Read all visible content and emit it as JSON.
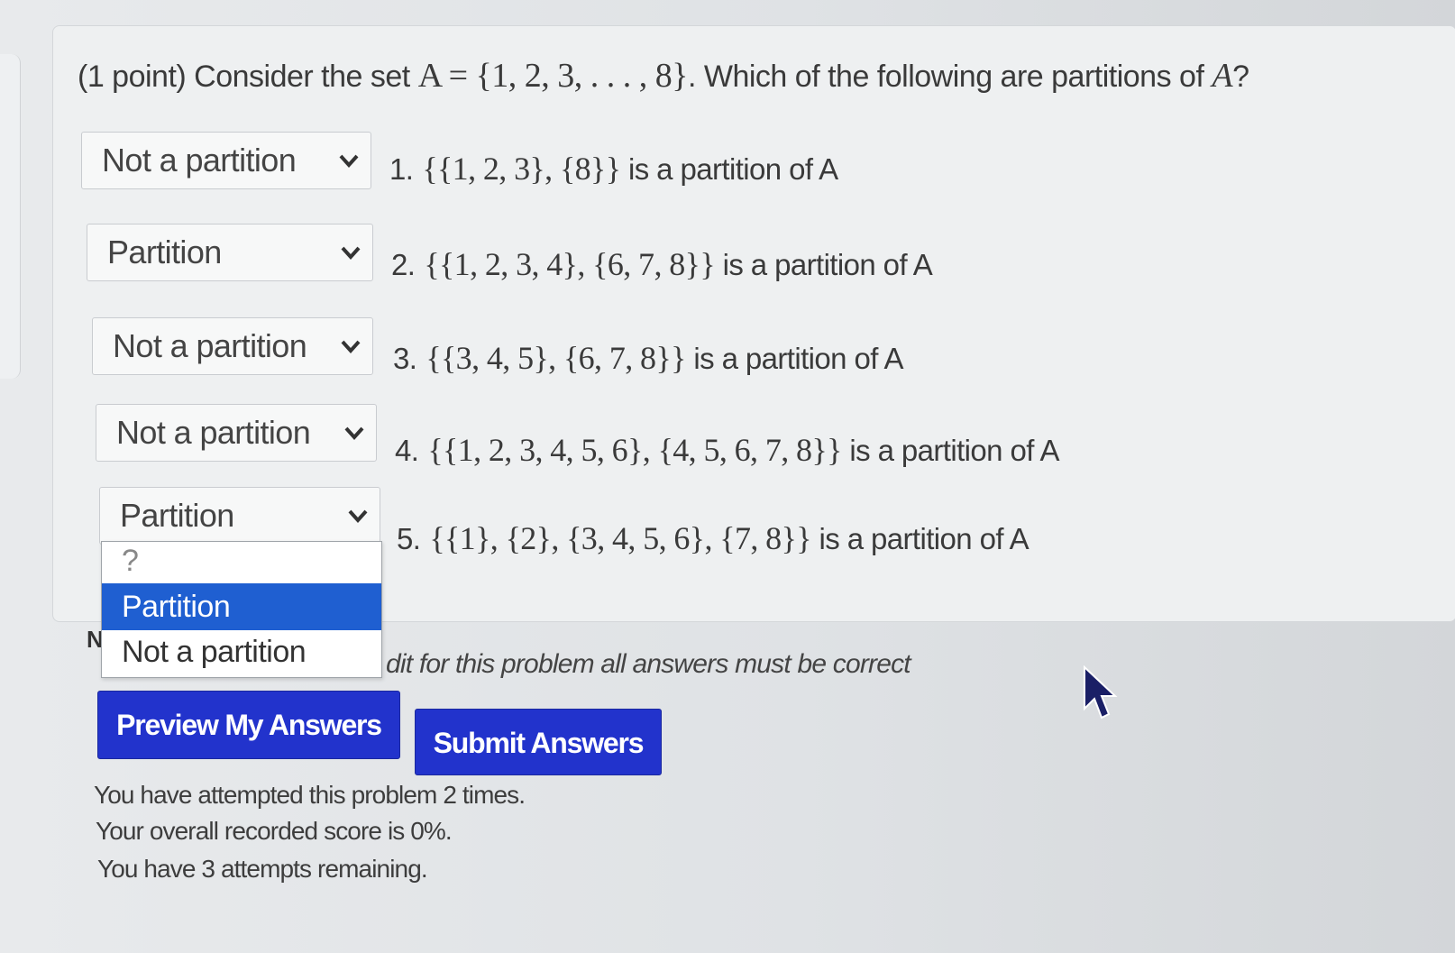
{
  "question": {
    "prefix": "(1 point) Consider the set",
    "set_math": "A = {1, 2, 3, . . . , 8}",
    "suffix": ". Which of the following are partitions of",
    "set_var": "A",
    "end": "?"
  },
  "items": [
    {
      "selected": "Not a partition",
      "number": "1.",
      "set_math": "{{1, 2, 3}, {8}}",
      "tail": "is a partition of A"
    },
    {
      "selected": "Partition",
      "number": "2.",
      "set_math": "{{1, 2, 3, 4}, {6, 7, 8}}",
      "tail": "is a partition of A"
    },
    {
      "selected": "Not a partition",
      "number": "3.",
      "set_math": "{{3, 4, 5}, {6, 7, 8}}",
      "tail": "is a partition of A"
    },
    {
      "selected": "Not a partition",
      "number": "4.",
      "set_math": "{{1, 2, 3, 4, 5, 6}, {4, 5, 6, 7, 8}}",
      "tail": "is a partition of A"
    },
    {
      "selected": "Partition",
      "number": "5.",
      "set_math": "{{1}, {2}, {3, 4, 5, 6}, {7, 8}}",
      "tail": "is a partition of A"
    }
  ],
  "dropdown": {
    "options": [
      "?",
      "Partition",
      "Not a partition"
    ],
    "highlighted": "Partition"
  },
  "note": {
    "prefix": "N",
    "visible_text": "dit for this problem all answers must be correct"
  },
  "buttons": {
    "preview": "Preview My Answers",
    "submit": "Submit Answers"
  },
  "status": {
    "attempts": "You have attempted this problem 2 times.",
    "score": "Your overall recorded score is 0%.",
    "remaining": "You have 3 attempts remaining."
  },
  "colors": {
    "button_blue": "#2233cc",
    "dropdown_highlight": "#1f5fd1"
  },
  "icons": {
    "select_arrow": "chevron-down-icon",
    "pointer": "mouse-cursor-icon"
  }
}
